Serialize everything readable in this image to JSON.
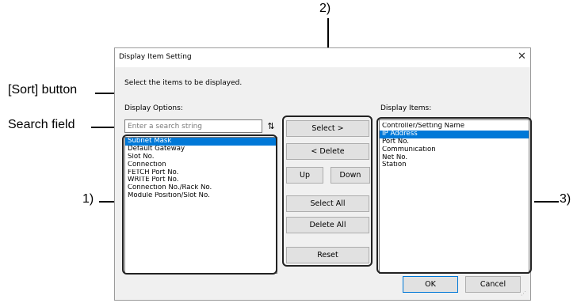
{
  "annotations": {
    "sort_button": "[Sort] button",
    "search_field": "Search field",
    "n1": "1)",
    "n2": "2)",
    "n3": "3)"
  },
  "dialog": {
    "title": "Display Item Setting",
    "close_glyph": "✕",
    "instruction": "Select the items to be displayed.",
    "options_label": "Display Options:",
    "items_label": "Display Items:",
    "search_placeholder": "Enter a search string",
    "search_value": "",
    "sort_glyph": "⇅",
    "options": [
      {
        "label": "Subnet Mask",
        "selected": true
      },
      {
        "label": "Default Gateway",
        "selected": false
      },
      {
        "label": "Slot No.",
        "selected": false
      },
      {
        "label": "Connection",
        "selected": false
      },
      {
        "label": "FETCH Port No.",
        "selected": false
      },
      {
        "label": "WRITE Port No.",
        "selected": false
      },
      {
        "label": "Connection No./Rack No.",
        "selected": false
      },
      {
        "label": "Module Position/Slot No.",
        "selected": false
      }
    ],
    "items": [
      {
        "label": "Controller/Setting Name",
        "selected": false
      },
      {
        "label": "IP Address",
        "selected": true
      },
      {
        "label": "Port No.",
        "selected": false
      },
      {
        "label": "Communication",
        "selected": false
      },
      {
        "label": "Net No.",
        "selected": false
      },
      {
        "label": "Station",
        "selected": false
      }
    ],
    "buttons": {
      "select": "Select >",
      "delete": "< Delete",
      "up": "Up",
      "down": "Down",
      "select_all": "Select All",
      "delete_all": "Delete All",
      "reset": "Reset",
      "ok": "OK",
      "cancel": "Cancel"
    }
  },
  "colors": {
    "selection": "#0078d7",
    "dialog_bg": "#f0f0f0"
  }
}
